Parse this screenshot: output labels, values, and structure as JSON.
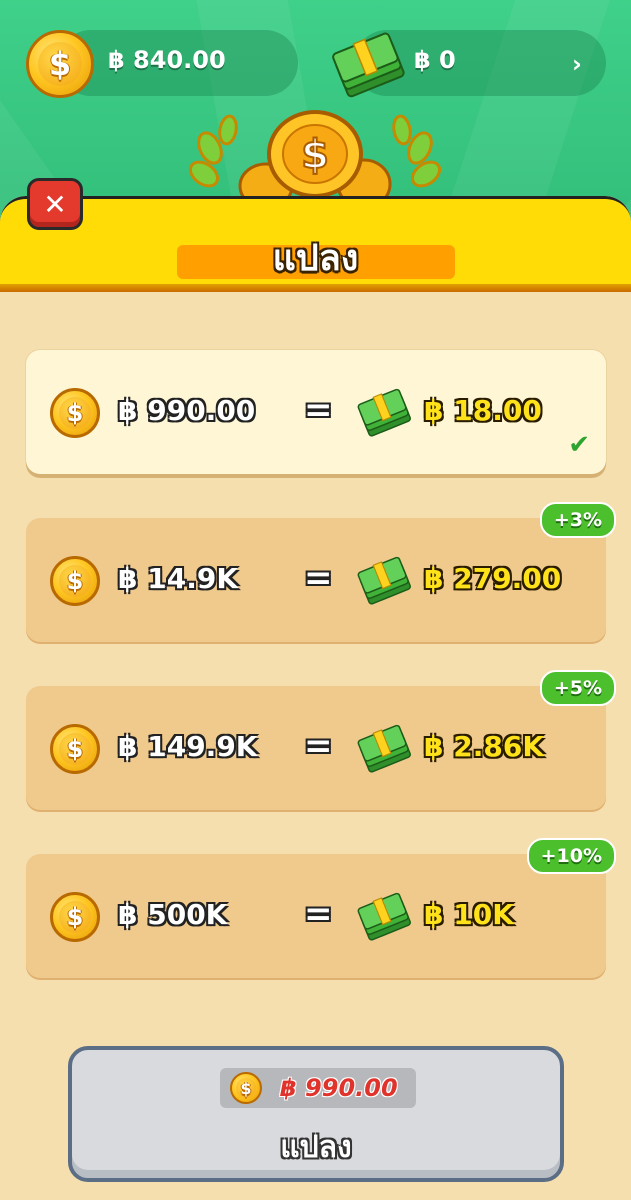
{
  "header": {
    "coin_balance": "฿ 840.00",
    "cash_balance": "฿ 0",
    "chevron": "›",
    "coin_icon": "dollar-coin-icon",
    "cash_icon": "cash-stack-icon"
  },
  "panel": {
    "title": "แปลง",
    "close_symbol": "✕"
  },
  "options": [
    {
      "coins": "฿ 990.00",
      "equals": "=",
      "cash": "฿ 18.00",
      "bonus": "",
      "selected": true,
      "check": "✔"
    },
    {
      "coins": "฿ 14.9K",
      "equals": "=",
      "cash": "฿ 279.00",
      "bonus": "+3%",
      "selected": false
    },
    {
      "coins": "฿ 149.9K",
      "equals": "=",
      "cash": "฿ 2.86K",
      "bonus": "+5%",
      "selected": false
    },
    {
      "coins": "฿ 500K",
      "equals": "=",
      "cash": "฿ 10K",
      "bonus": "+10%",
      "selected": false
    }
  ],
  "convert_button": {
    "cost": "฿ 990.00",
    "label": "แปลง"
  },
  "colors": {
    "top_green": "#3fd08a",
    "header_yellow": "#ffdc06",
    "panel_bg": "#f5dfaf",
    "option_bg": "#f0c98c",
    "bonus_green": "#4bbf2c",
    "cost_red": "#e0332b"
  }
}
